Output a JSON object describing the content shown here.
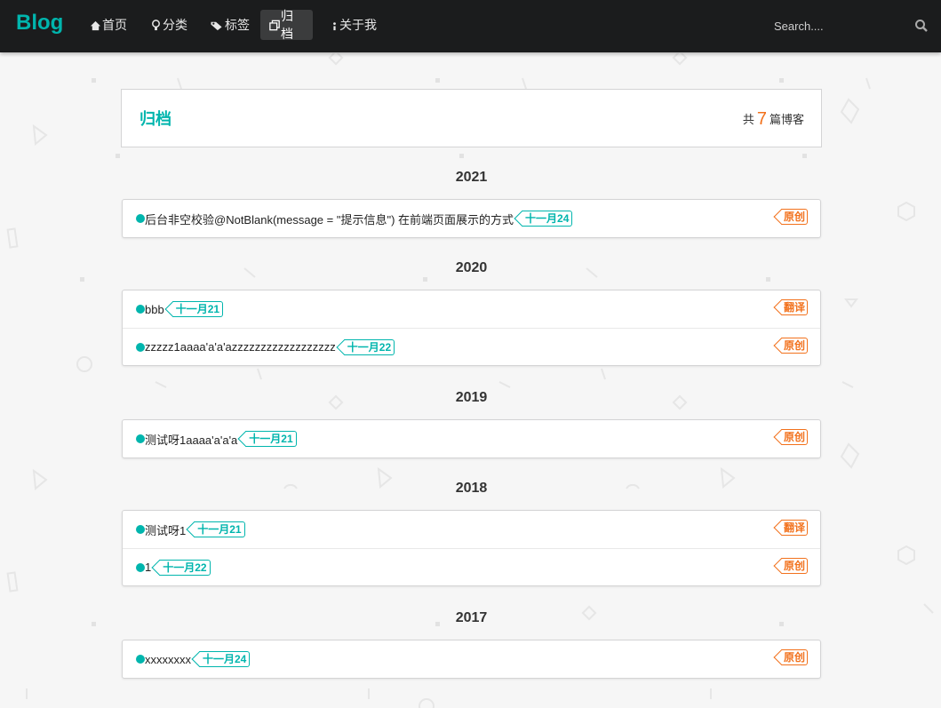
{
  "navbar": {
    "brand": "Blog",
    "items": [
      {
        "label": "首页",
        "icon": "home-icon",
        "active": false
      },
      {
        "label": "分类",
        "icon": "idea-icon",
        "active": false
      },
      {
        "label": "标签",
        "icon": "tags-icon",
        "active": false
      },
      {
        "label": "归档",
        "icon": "clone-icon",
        "active": true
      },
      {
        "label": "关于我",
        "icon": "info-icon",
        "active": false
      }
    ],
    "search_placeholder": "Search....",
    "search_icon": "search-icon"
  },
  "header": {
    "title": "归档",
    "count_prefix": "共",
    "count": "7",
    "count_suffix": "篇博客"
  },
  "years": [
    {
      "year": "2021",
      "posts": [
        {
          "title": "后台非空校验@NotBlank(message = \"提示信息\") 在前端页面展示的方式",
          "date": "十一月24",
          "type": "原创"
        }
      ]
    },
    {
      "year": "2020",
      "posts": [
        {
          "title": "bbb",
          "date": "十一月21",
          "type": "翻译"
        },
        {
          "title": "zzzzz1aaaa'a'a'azzzzzzzzzzzzzzzzzz",
          "date": "十一月22",
          "type": "原创"
        }
      ]
    },
    {
      "year": "2019",
      "posts": [
        {
          "title": "测试呀1aaaa'a'a'a",
          "date": "十一月21",
          "type": "原创"
        }
      ]
    },
    {
      "year": "2018",
      "posts": [
        {
          "title": "测试呀1",
          "date": "十一月21",
          "type": "翻译"
        },
        {
          "title": "1",
          "date": "十一月22",
          "type": "原创"
        }
      ]
    },
    {
      "year": "2017",
      "posts": [
        {
          "title": "xxxxxxxx",
          "date": "十一月24",
          "type": "原创"
        }
      ]
    }
  ],
  "colors": {
    "accent": "#00b5ad",
    "orange": "#f2711c",
    "navbar": "#1b1c1d",
    "background": "#f6f6f6"
  }
}
